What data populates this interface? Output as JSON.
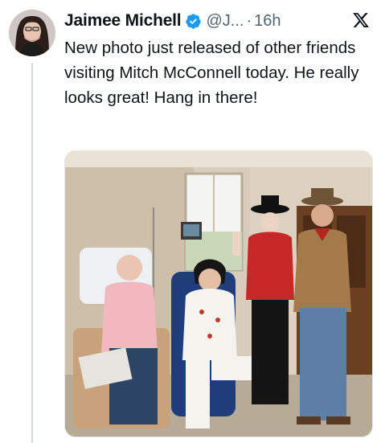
{
  "author": {
    "name": "Jaimee Michell",
    "handle": "@J...",
    "separator": "·",
    "time": "16h"
  },
  "tweet": {
    "text": "New photo just released of other friends visiting Mitch McConnell today. He really looks great! Hang in there!"
  },
  "icons": {
    "avatar": "profile-photo",
    "verified": "verified-badge-icon",
    "platform": "x-logo-icon"
  },
  "colors": {
    "verified_blue": "#1d9bf0",
    "text": "#0f1419",
    "secondary_text": "#536471"
  }
}
